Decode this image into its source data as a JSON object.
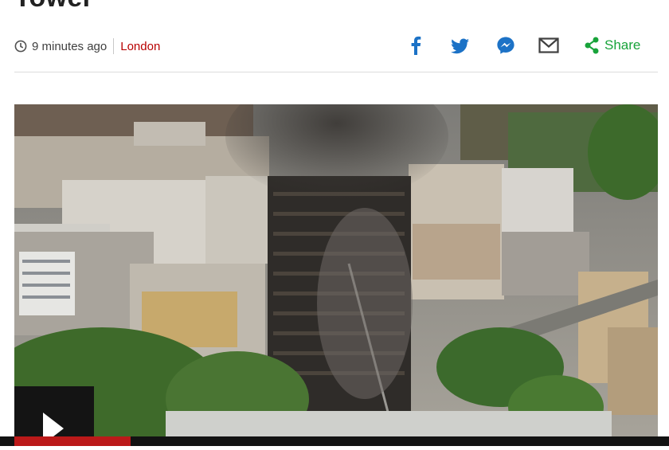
{
  "article": {
    "headline": "Tower",
    "timestamp": "9 minutes ago",
    "location": "London"
  },
  "share": {
    "facebook_icon": "facebook-icon",
    "twitter_icon": "twitter-icon",
    "messenger_icon": "messenger-icon",
    "email_icon": "email-icon",
    "share_icon": "share-icon",
    "share_label": "Share"
  },
  "media": {
    "description_icon": "play-icon",
    "progress": 0.17
  },
  "colors": {
    "accent": "#b80000",
    "share_green": "#18a33a",
    "icon_blue": "#1c72c6"
  }
}
